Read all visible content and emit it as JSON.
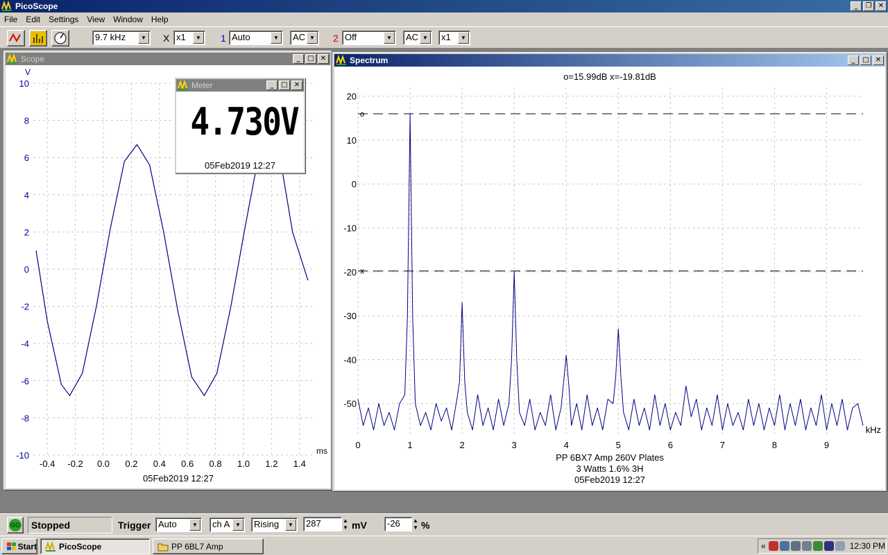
{
  "app": {
    "title": "PicoScope"
  },
  "menu": [
    "File",
    "Edit",
    "Settings",
    "View",
    "Window",
    "Help"
  ],
  "toolbar": {
    "timebase": "9.7 kHz",
    "x_label": "X",
    "x_mult": "x1",
    "ch1_label": "1",
    "ch1_range": "Auto",
    "ch1_coupling": "AC",
    "ch2_label": "2",
    "ch2_range": "Off",
    "ch2_coupling": "AC",
    "ch2_mult": "x1"
  },
  "scope": {
    "title": "Scope",
    "y_unit": "V",
    "x_unit": "ms",
    "timestamp": "05Feb2019  12:27",
    "y_ticks": [
      "10",
      "8",
      "6",
      "4",
      "2",
      "0",
      "-2",
      "-4",
      "-6",
      "-8",
      "-10"
    ],
    "x_ticks": [
      "-0.4",
      "-0.2",
      "0.0",
      "0.2",
      "0.4",
      "0.6",
      "0.8",
      "1.0",
      "1.2",
      "1.4"
    ]
  },
  "meter": {
    "title": "Meter",
    "reading": "4.730V",
    "timestamp": "05Feb2019  12:27"
  },
  "spectrum": {
    "title": "Spectrum",
    "cursor_readout": "o=15.99dB  x=-19.81dB",
    "x_unit": "kHz",
    "y_ticks": [
      "20",
      "10",
      "0",
      "-10",
      "-20",
      "-30",
      "-40",
      "-50"
    ],
    "x_ticks": [
      "0",
      "1",
      "2",
      "3",
      "4",
      "5",
      "6",
      "7",
      "8",
      "9"
    ],
    "cursor_o_marker": "o",
    "cursor_x_marker": "x",
    "notes": [
      "PP 6BX7  Amp 260V Plates",
      "3 Watts 1.6% 3H",
      "05Feb2019  12:27"
    ]
  },
  "status": {
    "go_label": "GO",
    "state": "Stopped",
    "trigger_label": "Trigger",
    "trigger_mode": "Auto",
    "trigger_channel": "ch A",
    "trigger_edge": "Rising",
    "trigger_level": "287",
    "trigger_level_unit": "mV",
    "pretrigger": "-26",
    "pretrigger_unit": "%"
  },
  "taskbar": {
    "start": "Start",
    "tasks": [
      "PicoScope",
      "PP 6BL7 Amp"
    ],
    "clock": "12:30 PM",
    "tray_chevron": "«"
  },
  "chart_data": [
    {
      "type": "line",
      "title": "Scope",
      "xlabel": "ms",
      "ylabel": "V",
      "xlim": [
        -0.5,
        1.5
      ],
      "ylim": [
        -10,
        10
      ],
      "grid": true,
      "series": [
        {
          "x": [
            -0.48,
            -0.4,
            -0.3,
            -0.24,
            -0.15,
            -0.05,
            0.05,
            0.15,
            0.24,
            0.33,
            0.43,
            0.53,
            0.63,
            0.72,
            0.81,
            0.91,
            1.01,
            1.1,
            1.2,
            1.27,
            1.35,
            1.46
          ],
          "values": [
            1.0,
            -2.8,
            -6.2,
            -6.8,
            -5.6,
            -2.0,
            2.2,
            5.8,
            6.7,
            5.6,
            2.0,
            -2.2,
            -5.8,
            -6.8,
            -5.6,
            -2.0,
            2.2,
            5.8,
            6.7,
            5.6,
            2.0,
            -0.6
          ]
        }
      ]
    },
    {
      "type": "line",
      "title": "Spectrum",
      "xlabel": "kHz",
      "ylabel": "",
      "xlim": [
        0,
        9.7
      ],
      "ylim": [
        -57,
        22
      ],
      "grid": true,
      "cursors": [
        15.99,
        -19.81
      ],
      "series": [
        {
          "x": [
            0.0,
            0.1,
            0.2,
            0.3,
            0.4,
            0.5,
            0.6,
            0.7,
            0.8,
            0.9,
            0.95,
            1.0,
            1.05,
            1.1,
            1.2,
            1.3,
            1.4,
            1.5,
            1.6,
            1.7,
            1.8,
            1.9,
            1.95,
            2.0,
            2.05,
            2.1,
            2.2,
            2.3,
            2.4,
            2.5,
            2.6,
            2.7,
            2.8,
            2.9,
            2.95,
            3.0,
            3.05,
            3.1,
            3.2,
            3.3,
            3.4,
            3.5,
            3.6,
            3.7,
            3.8,
            3.9,
            3.95,
            4.0,
            4.05,
            4.1,
            4.2,
            4.3,
            4.4,
            4.5,
            4.6,
            4.7,
            4.8,
            4.9,
            4.95,
            5.0,
            5.05,
            5.1,
            5.2,
            5.3,
            5.4,
            5.5,
            5.6,
            5.7,
            5.8,
            5.9,
            6.0,
            6.1,
            6.2,
            6.3,
            6.4,
            6.5,
            6.6,
            6.7,
            6.8,
            6.9,
            7.0,
            7.1,
            7.2,
            7.3,
            7.4,
            7.5,
            7.6,
            7.7,
            7.8,
            7.9,
            8.0,
            8.1,
            8.2,
            8.3,
            8.4,
            8.5,
            8.6,
            8.7,
            8.8,
            8.9,
            9.0,
            9.1,
            9.2,
            9.3,
            9.4,
            9.5,
            9.6,
            9.7
          ],
          "values": [
            -49,
            -55,
            -51,
            -56,
            -50,
            -55,
            -52,
            -56,
            -50,
            -48,
            -30,
            16,
            -30,
            -50,
            -55,
            -52,
            -56,
            -50,
            -54,
            -51,
            -56,
            -49,
            -45,
            -27,
            -45,
            -52,
            -56,
            -48,
            -55,
            -51,
            -56,
            -49,
            -55,
            -50,
            -40,
            -20,
            -40,
            -52,
            -55,
            -49,
            -56,
            -52,
            -55,
            -48,
            -56,
            -51,
            -45,
            -39,
            -46,
            -55,
            -50,
            -56,
            -48,
            -55,
            -51,
            -56,
            -49,
            -50,
            -44,
            -33,
            -44,
            -52,
            -56,
            -49,
            -55,
            -51,
            -56,
            -48,
            -55,
            -50,
            -56,
            -52,
            -55,
            -46,
            -53,
            -49,
            -56,
            -51,
            -55,
            -48,
            -56,
            -50,
            -55,
            -52,
            -56,
            -49,
            -55,
            -50,
            -56,
            -51,
            -55,
            -48,
            -56,
            -50,
            -55,
            -49,
            -56,
            -51,
            -55,
            -48,
            -56,
            -50,
            -55,
            -49,
            -56,
            -51,
            -50,
            -55
          ]
        }
      ]
    }
  ]
}
